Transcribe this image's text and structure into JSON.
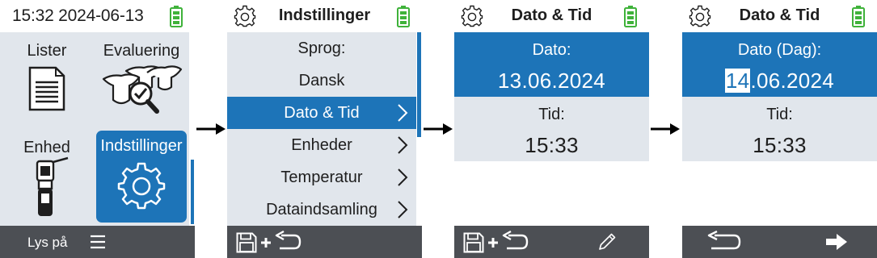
{
  "screens": {
    "main_menu": {
      "status_time": "15:32 2024-06-13",
      "tiles": [
        {
          "label": "Lister",
          "icon": "document-list-icon"
        },
        {
          "label": "Evaluering",
          "icon": "cow-evaluation-icon"
        },
        {
          "label": "Enhed",
          "icon": "handheld-device-icon"
        },
        {
          "label": "Indstillinger",
          "icon": "gear-icon",
          "selected": true
        }
      ],
      "footer_left": "Lys på",
      "footer_menu_icon": "hamburger-menu-icon"
    },
    "settings": {
      "title": "Indstillinger",
      "items": [
        {
          "label": "Sprog:",
          "chevron": false
        },
        {
          "label": "Dansk",
          "chevron": false
        },
        {
          "label": "Dato & Tid",
          "chevron": true,
          "selected": true
        },
        {
          "label": "Enheder",
          "chevron": true
        },
        {
          "label": "Temperatur",
          "chevron": true
        },
        {
          "label": "Dataindsamling",
          "chevron": true
        }
      ],
      "footer_icons": [
        "save-icon",
        "plus-icon",
        "back-arrow-icon"
      ]
    },
    "date_time": {
      "title": "Dato & Tid",
      "date_label": "Dato:",
      "date_value": "13.06.2024",
      "time_label": "Tid:",
      "time_value": "15:33",
      "footer_icons": [
        "save-icon",
        "plus-icon",
        "back-arrow-icon",
        "pencil-edit-icon"
      ]
    },
    "date_edit": {
      "title": "Dato & Tid",
      "date_label": "Dato (Dag):",
      "date_day_selected": "14",
      "date_rest": ".06.2024",
      "time_label": "Tid:",
      "time_value": "15:33",
      "footer_icons": [
        "back-arrow-icon",
        "right-arrow-icon"
      ]
    }
  },
  "colors": {
    "accent_blue": "#1d74b8",
    "panel_grey": "#e1e6ec",
    "footer_dark": "#4c4f54",
    "battery_green": "#3fb23a"
  }
}
